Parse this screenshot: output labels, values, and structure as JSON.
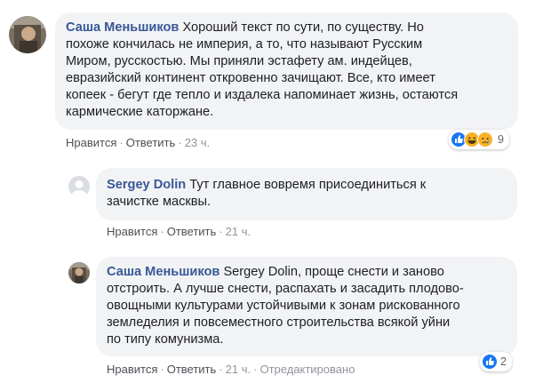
{
  "comments": [
    {
      "author": "Саша Меньшиков",
      "text_lines": [
        "Хороший текст по сути, по существу. Но",
        "похоже кончилась не империя, а то, что называют Русским",
        "Миром, русскостью. Мы приняли эстафету ам. индейцев,",
        "евразийский континент откровенно зачищают. Все, кто имеет",
        "копеек - бегут где тепло и издалека напоминает жизнь, остаются",
        "кармические каторжане."
      ],
      "like_label": "Нравится",
      "reply_label": "Ответить",
      "time": "23 ч.",
      "reactions": {
        "icons": [
          "like-icon",
          "haha-icon",
          "sad-icon"
        ],
        "count": "9"
      }
    },
    {
      "author": "Sergey Dolin",
      "text_lines": [
        "Тут главное вовремя присоединиться к",
        "зачистке масквы."
      ],
      "like_label": "Нравится",
      "reply_label": "Ответить",
      "time": "21 ч."
    },
    {
      "author": "Саша Меньшиков",
      "mention": "Sergey Dolin",
      "text_lines": [
        ", проще снести и заново",
        "отстроить. А лучше снести, распахать и засадить плодово-",
        "овощными культурами устойчивыми к зонам рискованного",
        "земледелия и повсеместного строительства всякой уйни",
        "по типу комунизма."
      ],
      "like_label": "Нравится",
      "reply_label": "Ответить",
      "time": "21 ч.",
      "edited_label": "Отредактировано",
      "reactions": {
        "icons": [
          "like-icon"
        ],
        "count": "2"
      }
    }
  ],
  "colors": {
    "author": "#385898",
    "bubble": "#f2f3f5",
    "like_blue": "#1877f2",
    "haha_yellow": "#f7b125"
  }
}
